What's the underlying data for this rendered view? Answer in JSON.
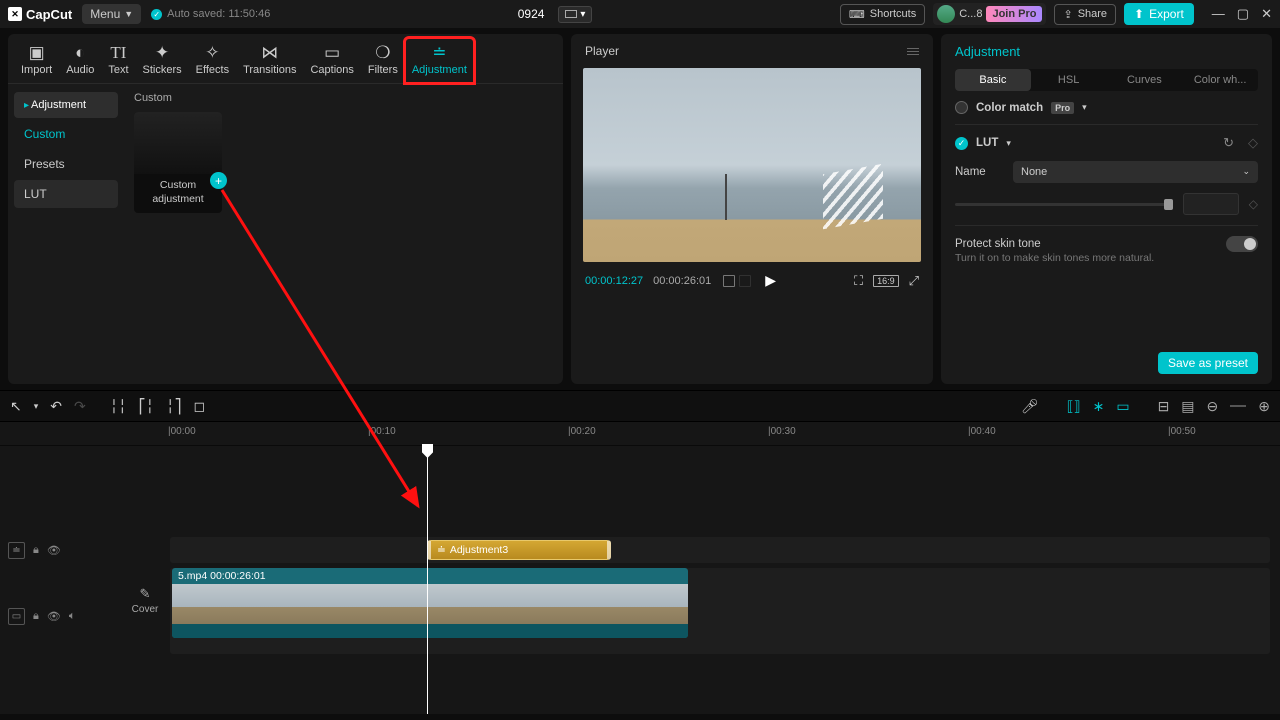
{
  "app": {
    "name": "CapCut",
    "menu": "Menu",
    "autosave": "Auto saved: 11:50:46",
    "project": "0924"
  },
  "titlebar": {
    "shortcuts": "Shortcuts",
    "user": "C...8",
    "joinpro": "Join Pro",
    "share": "Share",
    "export": "Export"
  },
  "tooltabs": [
    "Import",
    "Audio",
    "Text",
    "Stickers",
    "Effects",
    "Transitions",
    "Captions",
    "Filters",
    "Adjustment"
  ],
  "leftsidebar": {
    "cat": "Adjustment",
    "items": [
      "Custom",
      "Presets",
      "LUT"
    ]
  },
  "leftgrid": {
    "header": "Custom",
    "thumb": "Custom adjustment"
  },
  "player": {
    "title": "Player",
    "current": "00:00:12:27",
    "duration": "00:00:26:01",
    "ratio": "16:9"
  },
  "right": {
    "title": "Adjustment",
    "tabs": [
      "Basic",
      "HSL",
      "Curves",
      "Color wh..."
    ],
    "colormatch": "Color match",
    "lut": "LUT",
    "name": "Name",
    "none": "None",
    "protect": "Protect skin tone",
    "protectnote": "Turn it on to make skin tones more natural.",
    "save": "Save as preset"
  },
  "timeline": {
    "marks": [
      "00:00",
      "00:10",
      "00:20",
      "00:30",
      "00:40",
      "00:50"
    ],
    "adjclip": "Adjustment3",
    "vidclip": "5.mp4  00:00:26:01",
    "cover": "Cover"
  }
}
